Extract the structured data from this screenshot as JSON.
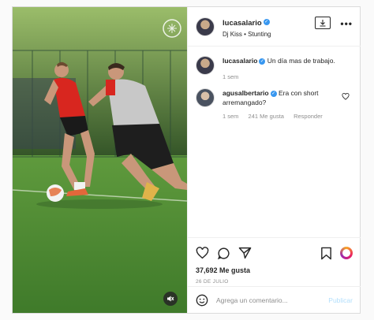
{
  "post": {
    "username": "lucasalario",
    "audio": "Dj Kiss • Stunting",
    "caption": "Un día mas de trabajo.",
    "caption_time": "1 sem"
  },
  "comment": {
    "username": "agusalbertario",
    "text": "Era con short arremangado?",
    "time": "1 sem",
    "likes": "241 Me gusta",
    "reply": "Responder"
  },
  "stats": {
    "likes": "37,692 Me gusta",
    "date": "26 DE JULIO"
  },
  "input": {
    "placeholder": "Agrega un comentario...",
    "publish": "Publicar"
  },
  "colors": {
    "verified": "#3897f0",
    "muted": "#8e8e8e",
    "publish_disabled": "#b2dffc"
  },
  "icons": [
    "verified-icon",
    "download-icon",
    "more-options-icon",
    "heart-icon",
    "comment-icon",
    "share-icon",
    "save-icon",
    "emoji-icon",
    "mute-icon",
    "club-crest-icon",
    "archive-ring-icon"
  ]
}
